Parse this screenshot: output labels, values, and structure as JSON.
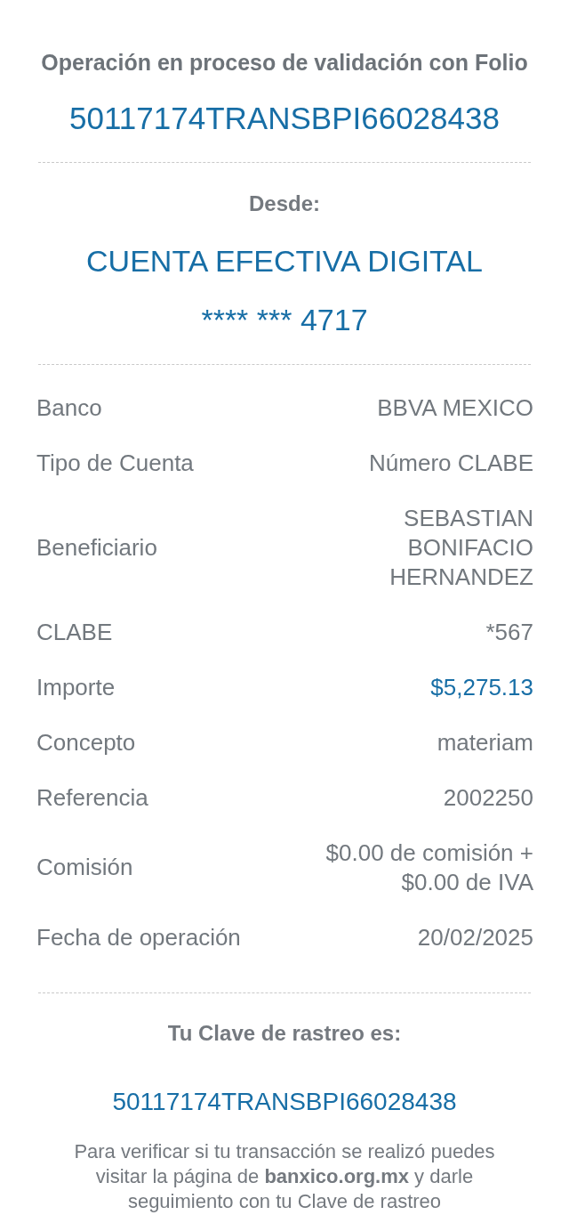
{
  "header": {
    "title": "Operación en proceso de validación con Folio",
    "folio": "50117174TRANSBPI66028438"
  },
  "origin": {
    "label": "Desde:",
    "account_name": "CUENTA EFECTIVA DIGITAL",
    "account_number": "**** *** 4717"
  },
  "details": [
    {
      "label": "Banco",
      "value": "BBVA MEXICO",
      "kind": "text"
    },
    {
      "label": "Tipo de Cuenta",
      "value": "Número CLABE",
      "kind": "text"
    },
    {
      "label": "Beneficiario",
      "value": "SEBASTIAN BONIFACIO HERNANDEZ",
      "kind": "text"
    },
    {
      "label": "CLABE",
      "value": "*567",
      "kind": "text"
    },
    {
      "label": "Importe",
      "value": "$5,275.13",
      "kind": "amount"
    },
    {
      "label": "Concepto",
      "value": "materiam",
      "kind": "text"
    },
    {
      "label": "Referencia",
      "value": "2002250",
      "kind": "text"
    },
    {
      "label": "Comisión",
      "value": "$0.00 de comisión + $0.00 de IVA",
      "kind": "text"
    },
    {
      "label": "Fecha de operación",
      "value": "20/02/2025",
      "kind": "text"
    }
  ],
  "tracking": {
    "label": "Tu Clave de rastreo es:",
    "code": "50117174TRANSBPI66028438",
    "note": "Para verificar si tu transacción se realizó puedes visitar la página de **banxico.org.mx** y darle seguimiento con tu Clave de rastreo"
  }
}
